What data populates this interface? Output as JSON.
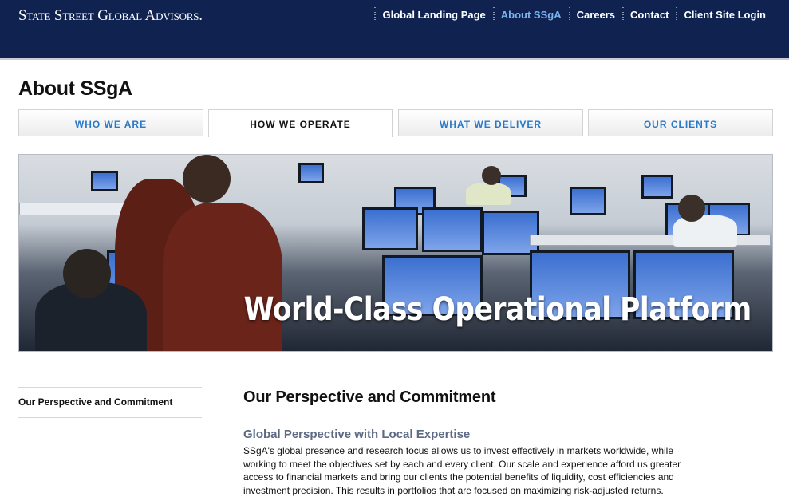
{
  "brand": {
    "logo_text": "State Street Global Advisors."
  },
  "topnav": {
    "items": [
      {
        "label": "Global Landing Page",
        "active": false
      },
      {
        "label": "About SSgA",
        "active": true
      },
      {
        "label": "Careers",
        "active": false
      },
      {
        "label": "Contact",
        "active": false
      },
      {
        "label": "Client Site Login",
        "active": false
      }
    ]
  },
  "page": {
    "title": "About SSgA"
  },
  "tabs": [
    {
      "label": "WHO WE ARE",
      "active": false
    },
    {
      "label": "HOW WE OPERATE",
      "active": true
    },
    {
      "label": "WHAT WE DELIVER",
      "active": false
    },
    {
      "label": "OUR CLIENTS",
      "active": false
    }
  ],
  "hero": {
    "title": "World-Class Operational Platform"
  },
  "sidenav": {
    "items": [
      {
        "label": "Our Perspective and Commitment"
      }
    ]
  },
  "content": {
    "heading": "Our Perspective and Commitment",
    "subheading": "Global Perspective with Local Expertise",
    "paragraph": "SSgA's global presence and research focus allows us to invest effectively in markets worldwide, while working to meet the objectives set by each and every client. Our scale and experience afford us greater access to financial markets and bring our clients the potential benefits of liquidity, cost efficiencies and investment precision. This results in portfolios that are focused on maximizing risk-adjusted returns."
  },
  "colors": {
    "header_bg": "#0f2250",
    "nav_active": "#7ab3ee",
    "tab_link": "#2a78c8",
    "subheading": "#5d6a84"
  }
}
